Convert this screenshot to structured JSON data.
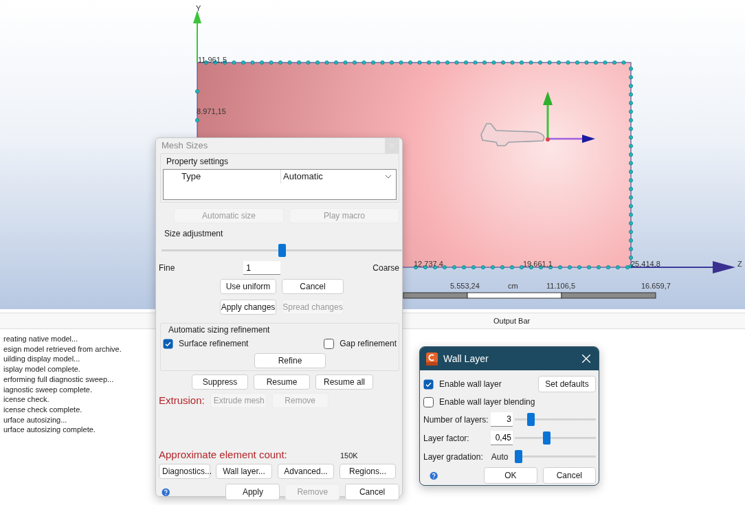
{
  "viewport": {
    "y_axis_label": "Y",
    "z_axis_label": "Z",
    "coordinate_labels": [
      "11.961,5",
      "8.971,15",
      "12.737,4",
      "19.661,1",
      "25.414,8"
    ],
    "scale_bar": {
      "labels": [
        "5.553,24",
        "11.106,5",
        "16.659,7"
      ],
      "unit": "cm"
    }
  },
  "output_bar": {
    "title": "Output Bar",
    "lines": [
      "reating native model...",
      "esign model retrieved from archive.",
      "uilding display model...",
      "isplay model complete.",
      "erforming full diagnostic sweep...",
      "iagnostic sweep complete.",
      "icense check.",
      "icense check complete.",
      "urface autosizing...",
      "urface autosizing complete."
    ]
  },
  "mesh_sizes": {
    "title": "Mesh Sizes",
    "property_settings": {
      "label": "Property settings",
      "rows": [
        {
          "name": "Type",
          "value": "Automatic"
        }
      ]
    },
    "property_buttons": [
      {
        "label": "Automatic size",
        "disabled": true
      },
      {
        "label": "Play macro",
        "disabled": true
      }
    ],
    "size_adjustment": {
      "label": "Size adjustment",
      "level": 0.5,
      "fine_label": "Fine",
      "value": "1",
      "coarse_label": "Coarse",
      "buttons": [
        {
          "label": "Use uniform",
          "disabled": false
        },
        {
          "label": "Cancel",
          "disabled": false
        },
        {
          "label": "Apply changes",
          "disabled": false
        },
        {
          "label": "Spread changes",
          "disabled": true
        }
      ]
    },
    "refinement": {
      "label": "Automatic sizing refinement",
      "options": [
        {
          "label": "Surface refinement",
          "checked": true
        },
        {
          "label": "Gap refinement",
          "checked": false
        }
      ],
      "refine_button": {
        "label": "Refine",
        "disabled": false
      }
    },
    "suppress_buttons": [
      {
        "label": "Suppress",
        "disabled": false
      },
      {
        "label": "Resume",
        "disabled": false
      },
      {
        "label": "Resume all",
        "disabled": false
      }
    ],
    "extrusion": {
      "label": "Extrusion:",
      "buttons": [
        {
          "label": "Extrude mesh",
          "disabled": true
        },
        {
          "label": "Remove",
          "disabled": true
        }
      ]
    },
    "element_count": {
      "label": "Approximate element count:",
      "value": "150K"
    },
    "tool_buttons": [
      {
        "label": "Diagnostics...",
        "disabled": false
      },
      {
        "label": "Wall layer...",
        "disabled": false
      },
      {
        "label": "Advanced...",
        "disabled": false
      },
      {
        "label": "Regions...",
        "disabled": false
      }
    ],
    "footer_buttons": [
      {
        "label": "Apply",
        "disabled": false
      },
      {
        "label": "Remove",
        "disabled": true
      },
      {
        "label": "Cancel",
        "disabled": false
      }
    ]
  },
  "wall_layer": {
    "title": "Wall Layer",
    "options": [
      {
        "label": "Enable wall layer",
        "checked": true
      },
      {
        "label": "Enable wall layer blending",
        "checked": false
      }
    ],
    "set_defaults": {
      "label": "Set defaults",
      "disabled": false
    },
    "sliders": [
      {
        "label": "Number of layers:",
        "kind": "field",
        "value": "3",
        "level": 0.17
      },
      {
        "label": "Layer factor:",
        "kind": "field",
        "value": "0,45",
        "level": 0.38
      },
      {
        "label": "Layer gradation:",
        "kind": "text",
        "value": "Auto",
        "level": 0.0
      }
    ],
    "buttons": [
      {
        "label": "OK",
        "disabled": false
      },
      {
        "label": "Cancel",
        "disabled": false
      }
    ]
  }
}
